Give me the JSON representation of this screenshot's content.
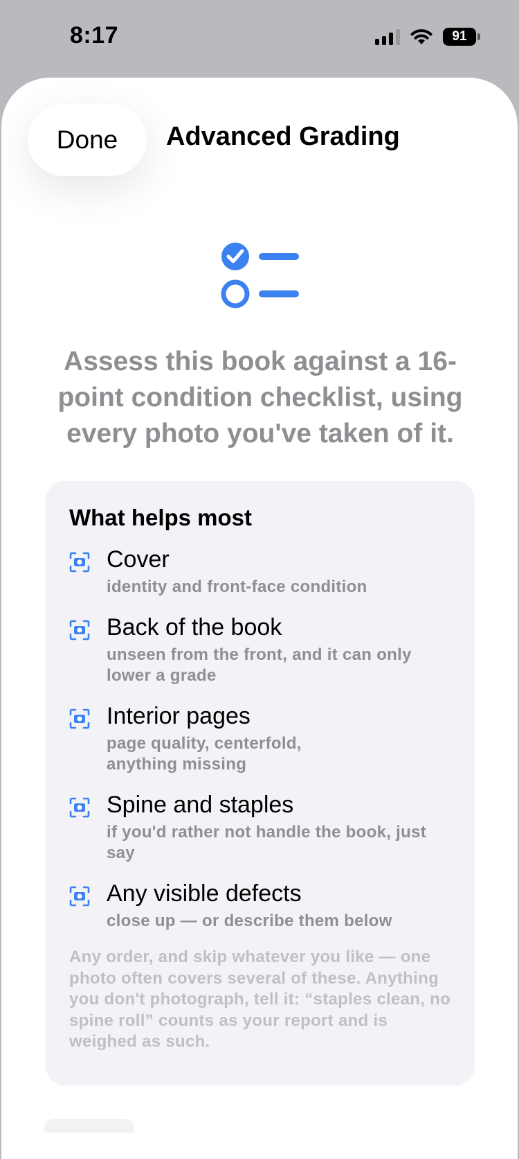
{
  "status_bar": {
    "time": "8:17",
    "battery": "91",
    "icons": [
      "signal-icon",
      "wifi-icon",
      "battery-icon"
    ]
  },
  "sheet": {
    "done_label": "Done",
    "title": "Advanced Grading",
    "header_icon": "checklist-icon",
    "intro": "Assess this book against a 16-point condition checklist, using every photo you've taken of it."
  },
  "tips": {
    "heading": "What helps most",
    "item_icon": "camera-viewfinder-icon",
    "items": [
      {
        "title": "Cover",
        "desc": "identity and front-face condition"
      },
      {
        "title": "Back of the book",
        "desc": "unseen from the front, and it can only lower a grade"
      },
      {
        "title": "Interior pages",
        "desc": "page quality, centerfold, anything missing"
      },
      {
        "title": "Spine and staples",
        "desc": "if you'd rather not handle the book, just say"
      },
      {
        "title": "Any visible defects",
        "desc": "close up — or describe them below"
      }
    ],
    "footnote": "Any order, and skip whatever you like — one photo often covers several of these. Anything you don't photograph, tell it: “staples clean, no spine roll” counts as your report and is weighed as such."
  },
  "colors": {
    "accent": "#3b82f0",
    "secondary_text": "#8e8e93",
    "card_bg": "#f2f2f7"
  }
}
